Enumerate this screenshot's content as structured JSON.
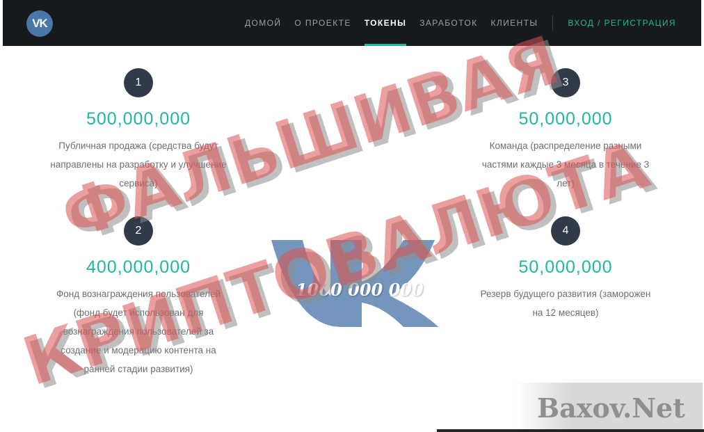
{
  "nav": {
    "logo": "VK",
    "items": [
      "ДОМОЙ",
      "О ПРОЕКТЕ",
      "ТОКЕНЫ",
      "ЗАРАБОТОК",
      "КЛИЕНТЫ"
    ],
    "active": "ТОКЕНЫ",
    "login": "ВХОД / РЕГИСТРАЦИЯ"
  },
  "tokens": [
    {
      "num": "1",
      "amount": "500,000,000",
      "desc_lines": [
        "Публичная продажа (средства будут",
        "направлены на разработку и улучшение",
        "сервиса)"
      ]
    },
    {
      "num": "2",
      "amount": "400,000,000",
      "desc_lines": [
        "Фонд вознаграждения пользователей",
        "(фонд будет использован для",
        "вознаграждения пользователей за",
        "создание и модерацию контента на",
        "ранней стадии развития)"
      ]
    },
    {
      "num": "3",
      "amount": "50,000,000",
      "desc_lines": [
        "Команда (распределение разными",
        "частями каждые 3 месяца в течение 3",
        "лет)"
      ]
    },
    {
      "num": "4",
      "amount": "50,000,000",
      "desc_lines": [
        "Резерв будущего развития (заморожен",
        "на 12 месяцев)"
      ]
    }
  ],
  "overlay": {
    "stamp_line1": "ФАЛЬШИВАЯ",
    "stamp_line2": "КРИПТОВАЛЮТА",
    "billion": "1000 000 000",
    "site": "Baxov.Net"
  },
  "colors": {
    "accent": "#1eb89d",
    "navbar": "#171a1d",
    "badge": "#313a48"
  }
}
